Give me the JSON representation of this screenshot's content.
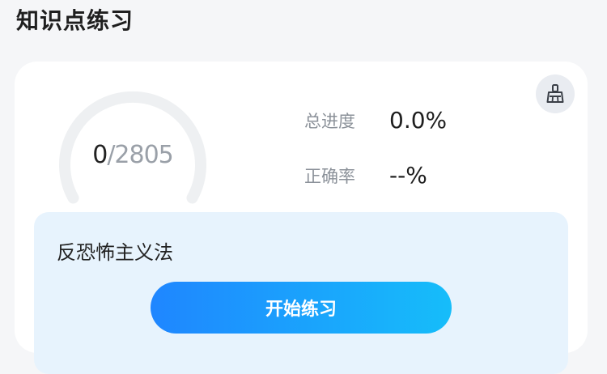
{
  "page": {
    "section_title": "知识点练习"
  },
  "progress_ring": {
    "completed": "0",
    "separator": "/",
    "total": "2805",
    "fraction_completed": 0
  },
  "stats": {
    "progress_label": "总进度",
    "progress_value": "0.0%",
    "accuracy_label": "正确率",
    "accuracy_value": "--%"
  },
  "topic": {
    "name": "反恐怖主义法",
    "start_button_label": "开始练习"
  },
  "icons": {
    "clean": "broom-icon"
  },
  "colors": {
    "accent_start": "#1f86ff",
    "accent_end": "#16bdfa",
    "panel_bg": "#e7f3fd",
    "ring_track": "#eef0f2"
  }
}
